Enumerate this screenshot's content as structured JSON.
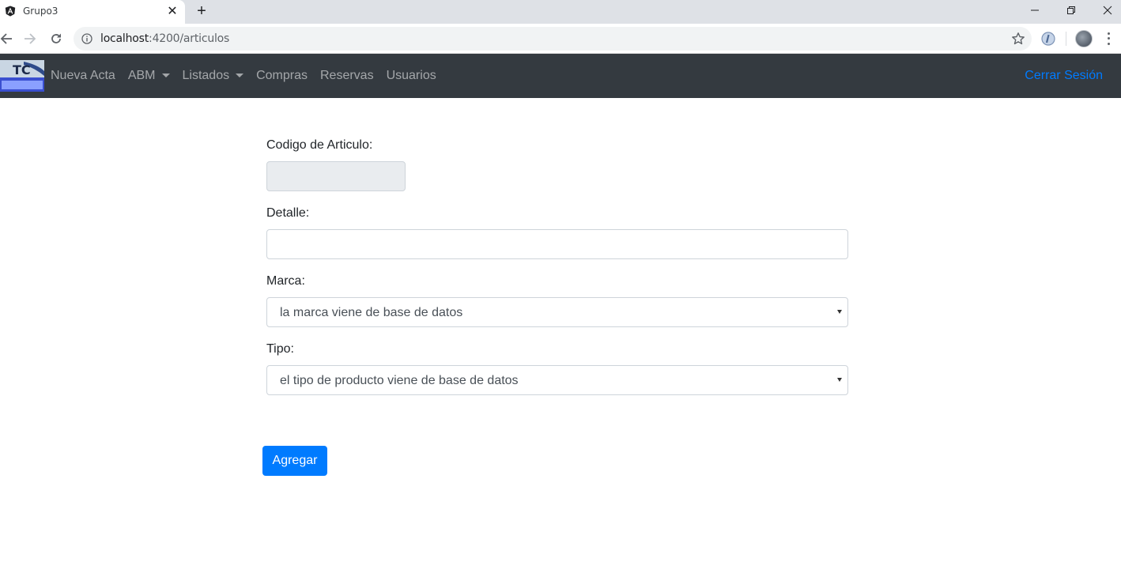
{
  "browser": {
    "tab_title": "Grupo3",
    "tab_close_glyph": "✕",
    "new_tab_glyph": "+",
    "url_host": "localhost",
    "url_path": ":4200/articulos",
    "icons": {
      "favicon": "angular-icon",
      "back": "back-arrow-icon",
      "forward": "forward-arrow-icon",
      "reload": "reload-icon",
      "info": "info-icon",
      "bookmark": "star-icon",
      "extension": "extension-icon",
      "profile": "avatar",
      "menu": "more-vert-icon",
      "minimize": "minimize-icon",
      "restore": "restore-icon",
      "close": "close-icon"
    }
  },
  "navbar": {
    "items": [
      {
        "label": "Nueva Acta",
        "dropdown": false
      },
      {
        "label": "ABM",
        "dropdown": true
      },
      {
        "label": "Listados",
        "dropdown": true
      },
      {
        "label": "Compras",
        "dropdown": false
      },
      {
        "label": "Reservas",
        "dropdown": false
      },
      {
        "label": "Usuarios",
        "dropdown": false
      }
    ],
    "logout_label": "Cerrar Sesión",
    "colors": {
      "background": "#343a40",
      "link": "rgba(255,255,255,0.55)",
      "logout": "#007bff"
    }
  },
  "form": {
    "codigo_label": "Codigo de Articulo:",
    "codigo_value": "",
    "detalle_label": "Detalle:",
    "detalle_value": "",
    "marca_label": "Marca:",
    "marca_selected": "la marca viene de base de datos",
    "tipo_label": "Tipo:",
    "tipo_selected": "el tipo de producto viene de base de datos",
    "submit_label": "Agregar"
  },
  "colors": {
    "primary": "#007bff",
    "disabled_input": "#e9ecef"
  }
}
